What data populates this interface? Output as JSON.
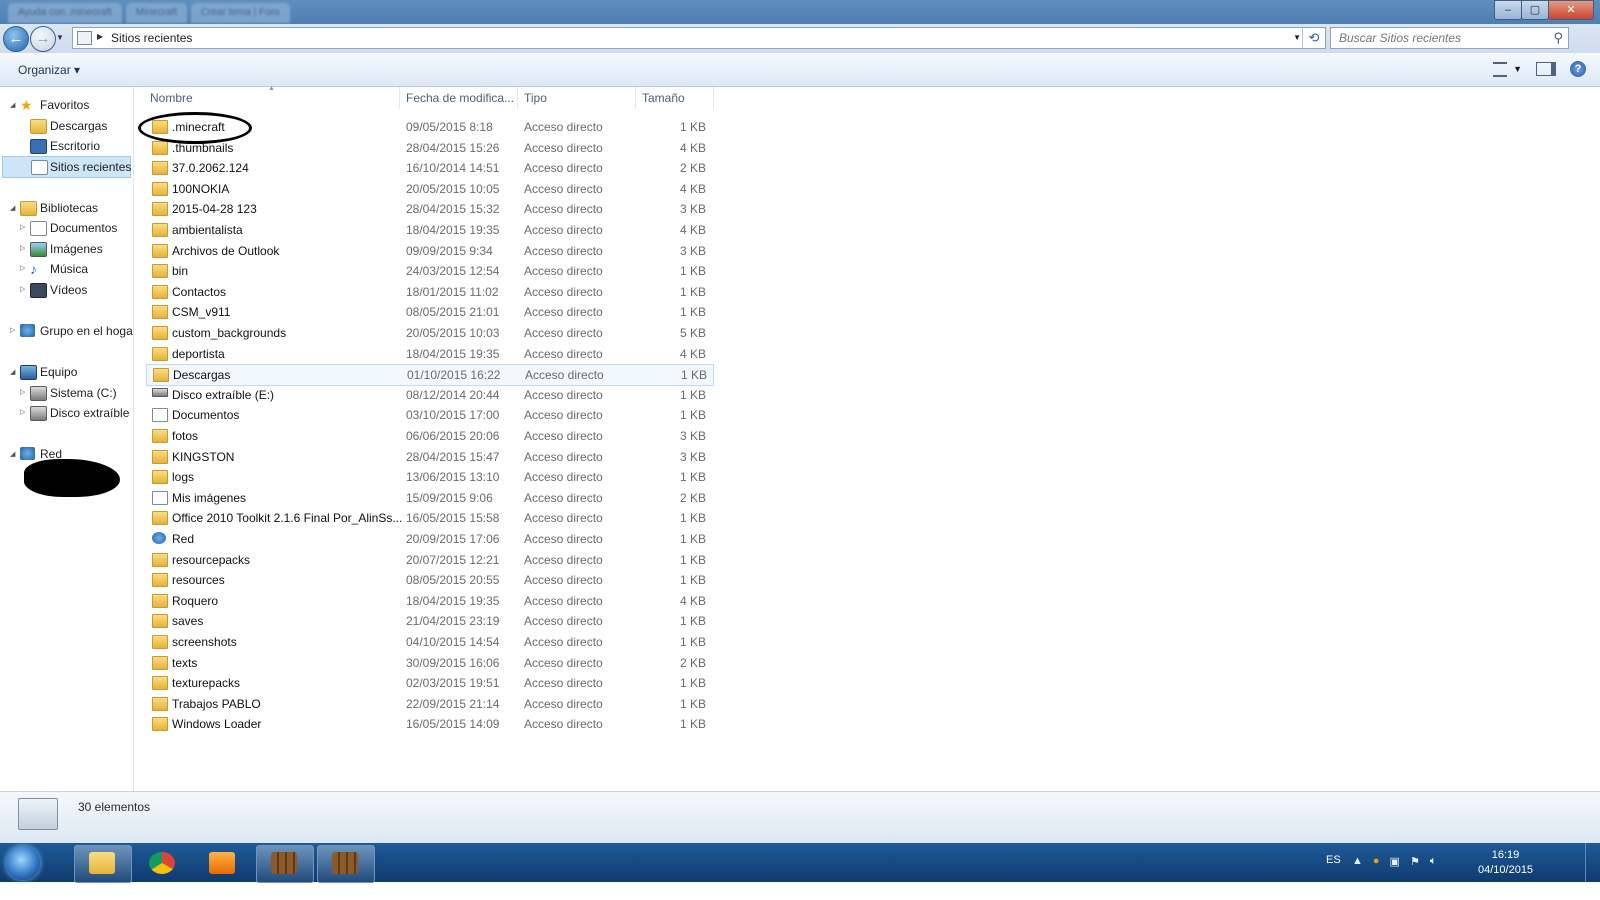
{
  "browser_tabs": [
    "Ayuda con .minecraft",
    "Minecraft",
    "Crear tema | Foro"
  ],
  "window_buttons": {
    "min": "–",
    "max": "▢",
    "close": "✕"
  },
  "address": {
    "path": "Sitios recientes"
  },
  "search": {
    "placeholder": "Buscar Sitios recientes"
  },
  "toolbar": {
    "organize": "Organizar"
  },
  "nav_pane": {
    "favoritos": "Favoritos",
    "descargas": "Descargas",
    "escritorio": "Escritorio",
    "sitios_recientes": "Sitios recientes",
    "bibliotecas": "Bibliotecas",
    "documentos": "Documentos",
    "imagenes": "Imágenes",
    "musica": "Música",
    "videos": "Vídeos",
    "grupo_hogar": "Grupo en el hogar",
    "equipo": "Equipo",
    "sistema": "Sistema (C:)",
    "disco_extraible": "Disco extraíble (",
    "red": "Red"
  },
  "columns": {
    "name": "Nombre",
    "date": "Fecha de modifica...",
    "type": "Tipo",
    "size": "Tamaño"
  },
  "files": [
    {
      "name": ".minecraft",
      "date": "09/05/2015 8:18",
      "type": "Acceso directo",
      "size": "1 KB",
      "icon": "folder"
    },
    {
      "name": ".thumbnails",
      "date": "28/04/2015 15:26",
      "type": "Acceso directo",
      "size": "4 KB",
      "icon": "folder"
    },
    {
      "name": "37.0.2062.124",
      "date": "16/10/2014 14:51",
      "type": "Acceso directo",
      "size": "2 KB",
      "icon": "folder"
    },
    {
      "name": "100NOKIA",
      "date": "20/05/2015 10:05",
      "type": "Acceso directo",
      "size": "4 KB",
      "icon": "folder"
    },
    {
      "name": "2015-04-28 123",
      "date": "28/04/2015 15:32",
      "type": "Acceso directo",
      "size": "3 KB",
      "icon": "folder"
    },
    {
      "name": "ambientalista",
      "date": "18/04/2015 19:35",
      "type": "Acceso directo",
      "size": "4 KB",
      "icon": "folder"
    },
    {
      "name": "Archivos de Outlook",
      "date": "09/09/2015 9:34",
      "type": "Acceso directo",
      "size": "3 KB",
      "icon": "folder"
    },
    {
      "name": "bin",
      "date": "24/03/2015 12:54",
      "type": "Acceso directo",
      "size": "1 KB",
      "icon": "folder"
    },
    {
      "name": "Contactos",
      "date": "18/01/2015 11:02",
      "type": "Acceso directo",
      "size": "1 KB",
      "icon": "folder"
    },
    {
      "name": "CSM_v911",
      "date": "08/05/2015 21:01",
      "type": "Acceso directo",
      "size": "1 KB",
      "icon": "folder"
    },
    {
      "name": "custom_backgrounds",
      "date": "20/05/2015 10:03",
      "type": "Acceso directo",
      "size": "5 KB",
      "icon": "folder"
    },
    {
      "name": "deportista",
      "date": "18/04/2015 19:35",
      "type": "Acceso directo",
      "size": "4 KB",
      "icon": "folder"
    },
    {
      "name": "Descargas",
      "date": "01/10/2015 16:22",
      "type": "Acceso directo",
      "size": "1 KB",
      "icon": "folder"
    },
    {
      "name": "Disco extraíble (E:)",
      "date": "08/12/2014 20:44",
      "type": "Acceso directo",
      "size": "1 KB",
      "icon": "drive"
    },
    {
      "name": "Documentos",
      "date": "03/10/2015 17:00",
      "type": "Acceso directo",
      "size": "1 KB",
      "icon": "doc"
    },
    {
      "name": "fotos",
      "date": "06/06/2015 20:06",
      "type": "Acceso directo",
      "size": "3 KB",
      "icon": "folder"
    },
    {
      "name": "KINGSTON",
      "date": "28/04/2015 15:47",
      "type": "Acceso directo",
      "size": "3 KB",
      "icon": "folder"
    },
    {
      "name": "logs",
      "date": "13/06/2015 13:10",
      "type": "Acceso directo",
      "size": "1 KB",
      "icon": "folder"
    },
    {
      "name": "Mis imágenes",
      "date": "15/09/2015 9:06",
      "type": "Acceso directo",
      "size": "2 KB",
      "icon": "doc"
    },
    {
      "name": "Office 2010 Toolkit 2.1.6 Final  Por_AlinSs...",
      "date": "16/05/2015 15:58",
      "type": "Acceso directo",
      "size": "1 KB",
      "icon": "folder"
    },
    {
      "name": "Red",
      "date": "20/09/2015 17:06",
      "type": "Acceso directo",
      "size": "1 KB",
      "icon": "net"
    },
    {
      "name": "resourcepacks",
      "date": "20/07/2015 12:21",
      "type": "Acceso directo",
      "size": "1 KB",
      "icon": "folder"
    },
    {
      "name": "resources",
      "date": "08/05/2015 20:55",
      "type": "Acceso directo",
      "size": "1 KB",
      "icon": "folder"
    },
    {
      "name": "Roquero",
      "date": "18/04/2015 19:35",
      "type": "Acceso directo",
      "size": "4 KB",
      "icon": "folder"
    },
    {
      "name": "saves",
      "date": "21/04/2015 23:19",
      "type": "Acceso directo",
      "size": "1 KB",
      "icon": "folder"
    },
    {
      "name": "screenshots",
      "date": "04/10/2015 14:54",
      "type": "Acceso directo",
      "size": "1 KB",
      "icon": "folder"
    },
    {
      "name": "texts",
      "date": "30/09/2015 16:06",
      "type": "Acceso directo",
      "size": "2 KB",
      "icon": "folder"
    },
    {
      "name": "texturepacks",
      "date": "02/03/2015 19:51",
      "type": "Acceso directo",
      "size": "1 KB",
      "icon": "folder"
    },
    {
      "name": "Trabajos PABLO",
      "date": "22/09/2015 21:14",
      "type": "Acceso directo",
      "size": "1 KB",
      "icon": "folder"
    },
    {
      "name": "Windows Loader",
      "date": "16/05/2015 14:09",
      "type": "Acceso directo",
      "size": "1 KB",
      "icon": "folder"
    }
  ],
  "status": {
    "count": "30 elementos"
  },
  "taskbar": {
    "lang": "ES",
    "time": "16:19",
    "date": "04/10/2015"
  },
  "colors": {
    "accent": "#2263a8",
    "selection": "#cde6f7",
    "folder": "#e5b33c"
  }
}
